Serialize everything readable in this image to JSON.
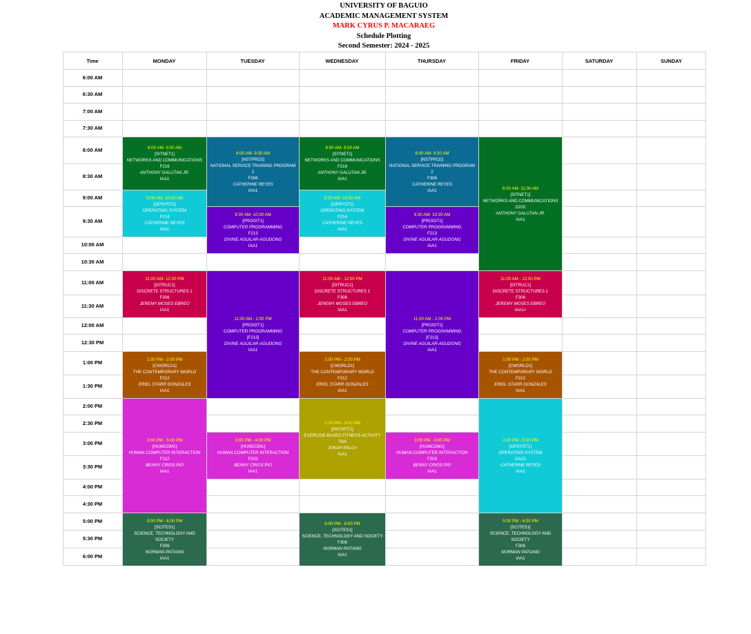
{
  "header": {
    "university": "UNIVERSITY OF BAGUIO",
    "system": "ACADEMIC MANAGEMENT SYSTEM",
    "student": "MARK CYRUS P. MACARAEG",
    "title": "Schedule Plotting",
    "semester": "Second Semester: 2024 - 2025"
  },
  "colors": {
    "networks": "#037023",
    "nstp": "#0b6b93",
    "opsys": "#10cbd7",
    "progit": "#6600c8",
    "ditruc": "#c8004b",
    "cworld": "#a75400",
    "humcom": "#d82ad5",
    "pathfit": "#aea200",
    "scites": "#2b6a4e",
    "time_text": "#ffff00",
    "grid": "#d3d3d3",
    "student_name": "#ff0000"
  },
  "schedule": {
    "time_header": "Time",
    "days": [
      "MONDAY",
      "TUESDAY",
      "WEDNESDAY",
      "THURSDAY",
      "FRIDAY",
      "SATURDAY",
      "SUNDAY"
    ],
    "times": [
      "6:00 AM",
      "6:30 AM",
      "7:00 AM",
      "7:30 AM",
      "8:00 AM",
      "8:30 AM",
      "9:00 AM",
      "9:30 AM",
      "10:00 AM",
      "10:30 AM",
      "11:00 AM",
      "11:30 AM",
      "12:00 AM",
      "12:30 PM",
      "1:00 PM",
      "1:30 PM",
      "2:00 PM",
      "2:30 PM",
      "3:00 PM",
      "3:30 PM",
      "4:00 PM",
      "4:30 PM",
      "5:00 PM",
      "5:30 PM",
      "6:00 PM"
    ],
    "classes": [
      {
        "day": 0,
        "start": 4,
        "end": 6,
        "color": "networks",
        "time": "8:00 AM- 9:00 AM",
        "code": "[SITNET1]",
        "title": "NETWORKS AND COMMUNICATIONS",
        "room": "F216",
        "instructor": "ANTHONY GALUTAN JR.",
        "section": "IAA1"
      },
      {
        "day": 0,
        "start": 6,
        "end": 8,
        "color": "opsys",
        "time": "9:00 AM- 10:00 AM",
        "code": "[OPSYST1]",
        "title": "OPERATING SYSTEM",
        "room": "F214",
        "instructor": "CATHERINE REYES",
        "section": "IAA1"
      },
      {
        "day": 0,
        "start": 10,
        "end": 12,
        "color": "ditruc",
        "time": "11:00 AM- 12:00 PM",
        "code": "[DITRUC1]",
        "title": "DISCRETE STRUCTURES 1",
        "room": "F306",
        "instructor": "JEREMY MOSES EBREO",
        "section": "IAA1"
      },
      {
        "day": 0,
        "start": 14,
        "end": 16,
        "color": "cworld",
        "time": "1:00 PM - 2:00 PM",
        "code": "[CWORLD1]",
        "title": "THE CONTEMPORARY WORLD",
        "room": "F212",
        "instructor": "ERIEL STARR GONZALES",
        "section": "IAA1"
      },
      {
        "day": 0,
        "start": 16,
        "end": 22,
        "color": "humcom",
        "time": "2:00 PM - 5:00 PM",
        "code": "[HUMCOM1]",
        "title": "HUMAN COMPUTER INTERACTION",
        "room": "F112",
        "instructor": "BENNY CRIOS PIO",
        "section": "IAA1"
      },
      {
        "day": 0,
        "start": 22,
        "end": 25,
        "color": "scites",
        "time": "5:00 PM - 6:00 PM",
        "code": "[SCITES1]",
        "title": "SCIENCE, TECHNOLOGY AND SOCIETY",
        "room": "F306",
        "instructor": "NORMAN PATIANG",
        "section": "IAA1"
      },
      {
        "day": 1,
        "start": 4,
        "end": 7,
        "color": "nstp",
        "time": "8:00 AM- 9:30 AM",
        "code": "[NSTPRO2]",
        "title": "NATIONAL SERVICE TRAINING PROGRAM 2",
        "room": "F306",
        "instructor": "CATHERINE REYES",
        "section": "IAA1"
      },
      {
        "day": 1,
        "start": 7,
        "end": 9,
        "color": "progit",
        "time": "9:30 AM- 10:30 AM",
        "code": "[PROGIT1]",
        "title": "COMPUTER PROGRAMMING",
        "room": "F213",
        "instructor": "DIVINE AGUILAR-AGUDONG",
        "section": "IAA1"
      },
      {
        "day": 1,
        "start": 10,
        "end": 16,
        "color": "progit",
        "time": "11:00 AM - 2:00 PM",
        "code": "[PROGIT1]",
        "title": "COMPUTER PROGRAMMING",
        "room": "[F213]",
        "instructor": "DIVINE AGUILAR-AGUDONG",
        "section": "IAA1"
      },
      {
        "day": 1,
        "start": 18,
        "end": 20,
        "color": "humcom",
        "time": "3:00 PM - 4:00 PM",
        "code": "[HUMCOM1]",
        "title": "HUMAN COMPUTER INTERACTION",
        "room": "F203",
        "instructor": "BENNY CRIOS PIO",
        "section": "IAA1"
      },
      {
        "day": 2,
        "start": 4,
        "end": 6,
        "color": "networks",
        "time": "8:00 AM- 9:00 AM",
        "code": "[SITNET1]",
        "title": "NETWORKS AND COMMUNICATIONS",
        "room": "F216",
        "instructor": "ANTHONY GALUTAN JR.",
        "section": "IAA1"
      },
      {
        "day": 2,
        "start": 6,
        "end": 8,
        "color": "opsys",
        "time": "9:00 AM- 10:00 AM",
        "code": "[OPSYST1]",
        "title": "OPERATING SYSTEM",
        "room": "F214",
        "instructor": "CATHERINE REYES",
        "section": "IAA1"
      },
      {
        "day": 2,
        "start": 10,
        "end": 12,
        "color": "ditruc",
        "time": "11:00 AM - 12:00 PM",
        "code": "[DITRUC1]",
        "title": "DISCRETE STRUCTURES 1",
        "room": "F306",
        "instructor": "JEREMY MOSES EBREO",
        "section": "IAA1"
      },
      {
        "day": 2,
        "start": 14,
        "end": 16,
        "color": "cworld",
        "time": "1:00 PM - 2:00 PM",
        "code": "[CWORLD1]",
        "title": "THE CONTEMPORARY WORLD",
        "room": "F212",
        "instructor": "ERIEL STARR GONZALES",
        "section": "IAA1"
      },
      {
        "day": 2,
        "start": 16,
        "end": 20,
        "color": "pathfit",
        "time": "2:00 PM - 4:00 PM",
        "code": "[PATHFIT2]",
        "title": "EXERCISE-BASED FITNESS ACTIVITY",
        "room": "TBA",
        "instructor": "JONAH PALO>",
        "section": "IAA1"
      },
      {
        "day": 2,
        "start": 22,
        "end": 25,
        "color": "scites",
        "time": "5:00 PM - 6:00 PM",
        "code": "[SCITES1]",
        "title": "SCIENCE, TECHNOLOGY AND SOCIETY",
        "room": "F306",
        "instructor": "NORMAN PATIANG",
        "section": "IAA1"
      },
      {
        "day": 3,
        "start": 4,
        "end": 7,
        "color": "nstp",
        "time": "8:00 AM- 9:30 AM",
        "code": "[NSTPRO2]",
        "title": "NATIONAL SERVICE TRAINING PROGRAM 2",
        "room": "F306",
        "instructor": "CATHERINE REYES",
        "section": "IAA1"
      },
      {
        "day": 3,
        "start": 7,
        "end": 9,
        "color": "progit",
        "time": "9:30 AM- 10:30 AM",
        "code": "[PROGIT1]",
        "title": "COMPUTER PROGRAMMING",
        "room": "F213",
        "instructor": "DIVINE AGUILAR-AGUDONG",
        "section": "IAA1"
      },
      {
        "day": 3,
        "start": 10,
        "end": 16,
        "color": "progit",
        "time": "11:00 AM - 2:00 PM",
        "code": "[PROGIT1]",
        "title": "COMPUTER PROGRAMMING",
        "room": "[F213]",
        "instructor": "DIVINE AGUILAR-AGUDONG",
        "section": "IAA1"
      },
      {
        "day": 3,
        "start": 18,
        "end": 20,
        "color": "humcom",
        "time": "3:00 PM - 4:00 PM",
        "code": "[HUMCOM1]",
        "title": "HUMAN COMPUTER INTERACTION",
        "room": "F203",
        "instructor": "BENNY CRIOS PIO",
        "section": "IAA1"
      },
      {
        "day": 4,
        "start": 4,
        "end": 10,
        "color": "networks",
        "time": "8:00 AM- 11:00 AM",
        "code": "[SITNET1]",
        "title": "NETWORKS AND COMMUNICATIONS",
        "room": "D202",
        "instructor": "ANTHONY GALUTAN JR.",
        "section": "IAA1"
      },
      {
        "day": 4,
        "start": 10,
        "end": 12,
        "color": "ditruc",
        "time": "11:00 AM - 12:00 PM",
        "code": "[DITRUC1]",
        "title": "DISCRETE STRUCTURES 1",
        "room": "F306",
        "instructor": "JEREMY MOSES EBREO",
        "section": "IAA1>"
      },
      {
        "day": 4,
        "start": 14,
        "end": 16,
        "color": "cworld",
        "time": "1:00 PM - 2:00 PM",
        "code": "[CWORLD1]",
        "title": "THE CONTEMPORARY WORLD",
        "room": "F212",
        "instructor": "ERIEL STARR GONZALES",
        "section": "IAA1"
      },
      {
        "day": 4,
        "start": 16,
        "end": 22,
        "color": "opsys",
        "time": "2:00 PM - 5:00 PM",
        "code": "[OPSYST1]",
        "title": "OPERATING SYSTEM",
        "room": "CAO1",
        "instructor": "CATHERINE REYES",
        "section": "IAA1"
      },
      {
        "day": 4,
        "start": 22,
        "end": 25,
        "color": "scites",
        "time": "5:00 PM - 6:00 PM",
        "code": "[SCITES1]",
        "title": "SCIENCE, TECHNOLOGY AND SOCIETY",
        "room": "F306",
        "instructor": "NORMAN PATIANG",
        "section": "IAA1"
      }
    ]
  }
}
